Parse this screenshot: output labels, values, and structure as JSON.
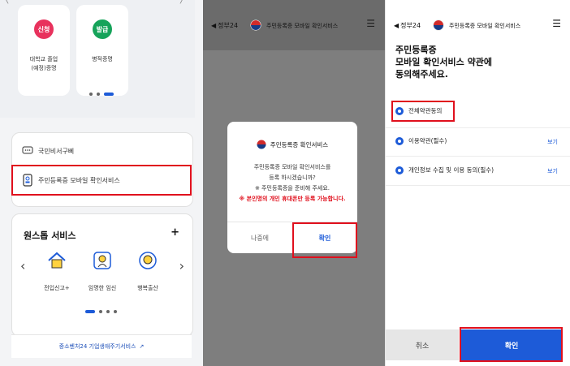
{
  "colors": {
    "primary": "#1d5bd8",
    "highlight": "#e0101d",
    "apply_badge": "#e8325d",
    "issue_badge": "#16a35a"
  },
  "panel1": {
    "services": [
      {
        "badge": "신청",
        "line1": "대학교 졸업",
        "line2": "(예정)증명"
      },
      {
        "badge": "발급",
        "line1": "병적증명",
        "line2": ""
      }
    ],
    "menu": {
      "secretary": "국민비서구삐",
      "mobile_id": "주민등록증 모바일 확인서비스"
    },
    "onestop": {
      "title": "원스톱 서비스",
      "plus": "+",
      "items": [
        "전입신고+",
        "임명한 임신",
        "행복출산"
      ]
    },
    "bottom_link": "중소벤처24 기업생애주기서비스"
  },
  "panel2": {
    "back": "정부24",
    "title": "주민등록증 모바일 확인서비스",
    "dialog": {
      "heading": "주민등록증 확인서비스",
      "line1": "주민등록증 모바일 확인서비스를",
      "line2": "등록 하시겠습니까?",
      "line3": "※ 주민등록증을 준비해 주세요.",
      "warning": "※ 본인명의 개인 휴대폰만 등록 가능합니다.",
      "later": "나중에",
      "confirm": "확인"
    }
  },
  "panel3": {
    "back": "정부24",
    "title": "주민등록증 모바일 확인서비스",
    "heading1": "주민등록증",
    "heading2": "모바일 확인서비스 약관에",
    "heading3": "동의해주세요.",
    "agree_all": "전체약관동의",
    "terms": [
      {
        "label": "이용약관(필수)",
        "view": "보기"
      },
      {
        "label": "개인정보 수집 및 이용 동의(필수)",
        "view": "보기"
      }
    ],
    "cancel": "취소",
    "confirm": "확인"
  }
}
